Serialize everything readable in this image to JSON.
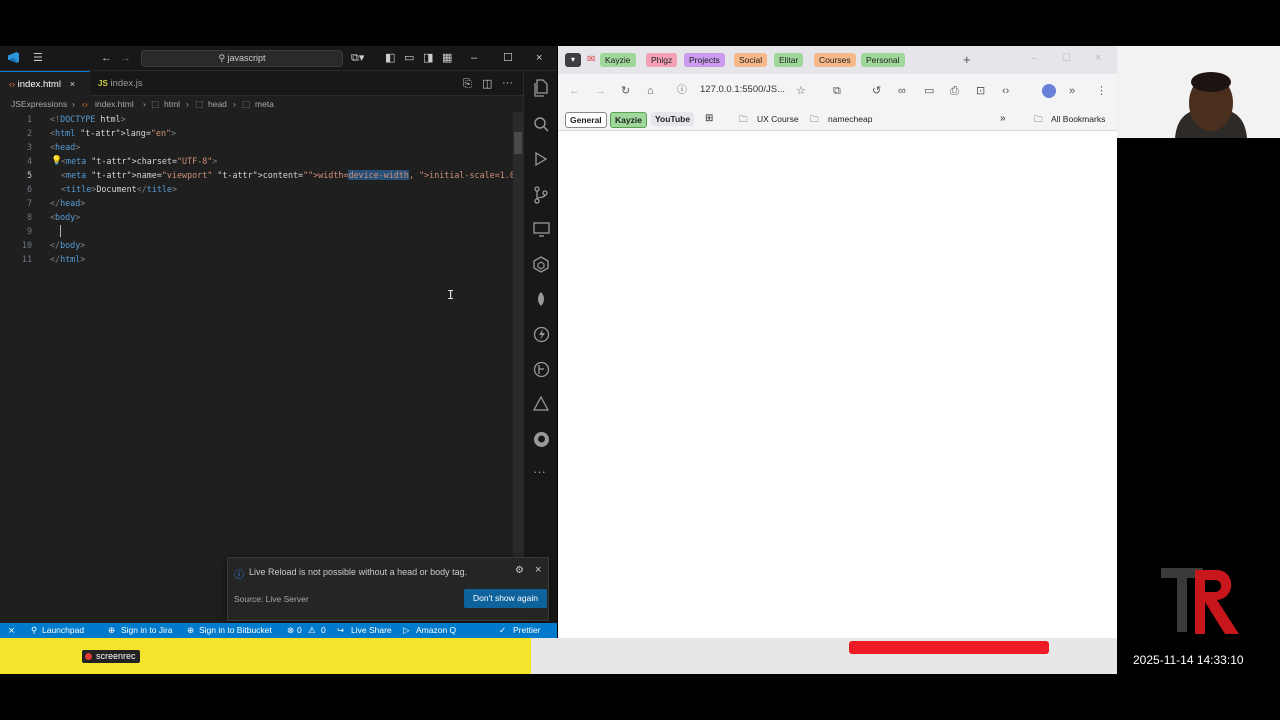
{
  "vscode": {
    "search_placeholder": "javascript",
    "tabs": [
      {
        "label": "index.html",
        "icon": "html-file-icon",
        "active": true
      },
      {
        "label": "index.js",
        "icon": "js-file-icon",
        "active": false
      }
    ],
    "close_glyph": "×",
    "breadcrumb": [
      "JSExpressions",
      "index.html",
      "html",
      "head",
      "meta"
    ],
    "code_lines": [
      {
        "n": "1",
        "text": "<!DOCTYPE html>"
      },
      {
        "n": "2",
        "text": "<html lang=\"en\">"
      },
      {
        "n": "3",
        "text": "<head>"
      },
      {
        "n": "4",
        "text": "<meta charset=\"UTF-8\">"
      },
      {
        "n": "5",
        "text": "<meta name=\"viewport\" content=\"width=device-width, initial-scale=1.0\">"
      },
      {
        "n": "6",
        "text": "<title>Document</title>"
      },
      {
        "n": "7",
        "text": "</head>"
      },
      {
        "n": "8",
        "text": "<body>"
      },
      {
        "n": "9",
        "text": ""
      },
      {
        "n": "10",
        "text": "</body>"
      },
      {
        "n": "11",
        "text": "</html>"
      }
    ],
    "notification": {
      "message": "Live Reload is not possible without a head or body tag.",
      "source": "Source: Live Server",
      "button": "Don't show again"
    },
    "status_bar": {
      "launchpad": "Launchpad",
      "jira": "Sign in to Jira",
      "bitbucket": "Sign in to Bitbucket",
      "errors": "0",
      "warnings": "0",
      "liveshare": "Live Share",
      "amazonq": "Amazon Q",
      "prettier": "Prettier"
    }
  },
  "browser": {
    "tab_groups": [
      {
        "label": "Kayzie",
        "color": "#9fd89a"
      },
      {
        "label": "Phigz",
        "color": "#f4a0b5"
      },
      {
        "label": "Projects",
        "color": "#cc9bef"
      },
      {
        "label": "Social",
        "color": "#f7b98a"
      },
      {
        "label": "Elitar",
        "color": "#9fd89a"
      },
      {
        "label": "Courses",
        "color": "#f7b98a"
      },
      {
        "label": "Personal",
        "color": "#9fd89a"
      }
    ],
    "new_tab_glyph": "+",
    "address": "127.0.0.1:5500/JS...",
    "bookmarks": {
      "general": "General",
      "kayzie": "Kayzie",
      "youtube": "YouTube",
      "ux_course": "UX Course",
      "namecheap": "namecheap",
      "all_bookmarks": "All Bookmarks"
    }
  },
  "overlay": {
    "screenrec": "screenrec",
    "timestamp": "2025-11-14 14:33:10"
  }
}
